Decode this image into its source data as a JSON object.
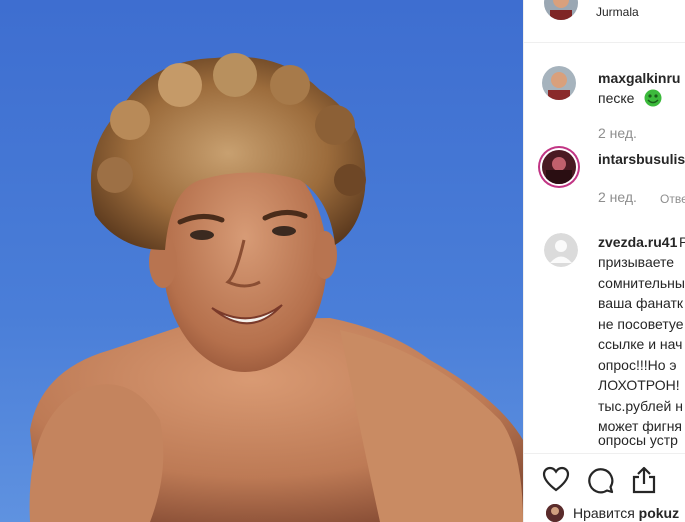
{
  "header": {
    "location": "Jurmala"
  },
  "comments": [
    {
      "username": "maxgalkinru",
      "lines": [
        "песке"
      ],
      "emoji_icon": "money-mouth-face-emoji",
      "time": "2 нед.",
      "reply": ""
    },
    {
      "username": "intarsbusulis",
      "lines": [],
      "time": "2 нед.",
      "reply": "Отве"
    },
    {
      "username": "zvezda.ru41",
      "extra": "Р",
      "lines": [
        "призываете",
        "сомнительны",
        "ваша фанатк",
        "не посоветуе",
        "ссылке и нач",
        "опрос!!!Но э",
        "ЛОХОТРОН!",
        "тыс.рублей н",
        "может фигня",
        "опросы устр"
      ]
    }
  ],
  "actions": {
    "like_icon": "heart-icon",
    "comment_icon": "comment-icon",
    "share_icon": "share-icon"
  },
  "likes": {
    "prefix": "Нравится",
    "user": "pokuz"
  },
  "colors": {
    "sky": "#3d6fd1",
    "text": "#262626",
    "muted": "#8e8e8e",
    "story_ring": "#c13584"
  }
}
